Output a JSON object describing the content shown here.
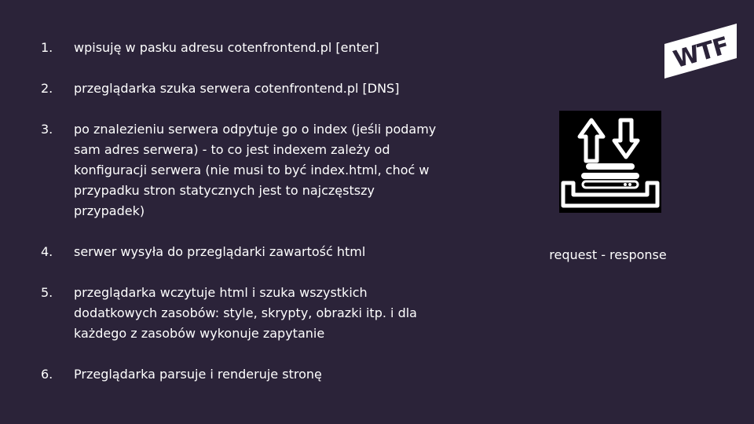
{
  "steps": [
    {
      "num": "1.",
      "text": "wpisuję w pasku adresu cotenfrontend.pl [enter]"
    },
    {
      "num": "2.",
      "text": "przeglądarka szuka serwera cotenfrontend.pl [DNS]"
    },
    {
      "num": "3.",
      "text": "po znalezieniu serwera odpytuje go o index (jeśli podamy sam adres serwera) - to co jest indexem zależy od konfiguracji serwera (nie musi to być index.html, choć w przypadku stron statycznych jest to najczęstszy przypadek)"
    },
    {
      "num": "4.",
      "text": "serwer wysyła do przeglądarki zawartość html"
    },
    {
      "num": "5.",
      "text": "przeglądarka wczytuje html i szuka wszystkich dodatkowych zasobów: style, skrypty, obrazki itp. i dla każdego z zasobów wykonuje zapytanie"
    },
    {
      "num": "6.",
      "text": "Przeglądarka parsuje i renderuje stronę"
    }
  ],
  "logo": {
    "text": "WTF"
  },
  "icon": {
    "name": "request-response-icon"
  },
  "caption": "request - response",
  "colors": {
    "background": "#2b2339",
    "text": "#ffffff",
    "icon_bg": "#000000"
  }
}
